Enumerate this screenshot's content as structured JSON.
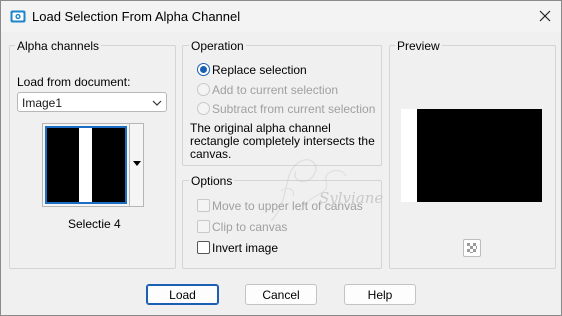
{
  "window": {
    "title": "Load Selection From Alpha Channel",
    "close_icon": "close-icon",
    "app_icon": "camera-icon"
  },
  "alpha_channels": {
    "legend": "Alpha channels",
    "load_from_label": "Load from document:",
    "document_value": "Image1",
    "selection_name": "Selectie 4"
  },
  "operation": {
    "legend": "Operation",
    "options": [
      {
        "label": "Replace selection",
        "checked": true,
        "enabled": true
      },
      {
        "label": "Add to current selection",
        "checked": false,
        "enabled": false
      },
      {
        "label": "Subtract from current selection",
        "checked": false,
        "enabled": false
      }
    ],
    "info_text": "The original alpha channel rectangle completely intersects the canvas."
  },
  "options": {
    "legend": "Options",
    "items": [
      {
        "label": "Move to upper left of canvas",
        "checked": false,
        "enabled": false
      },
      {
        "label": "Clip to canvas",
        "checked": false,
        "enabled": false
      },
      {
        "label": "Invert image",
        "checked": false,
        "enabled": true
      }
    ]
  },
  "preview": {
    "legend": "Preview",
    "transparency_icon": "checkerboard-icon"
  },
  "watermark": "Sylviane",
  "buttons": {
    "load": "Load",
    "cancel": "Cancel",
    "help": "Help"
  },
  "colors": {
    "accent": "#1b5fb3",
    "disabled_text": "#a0a0a0"
  }
}
